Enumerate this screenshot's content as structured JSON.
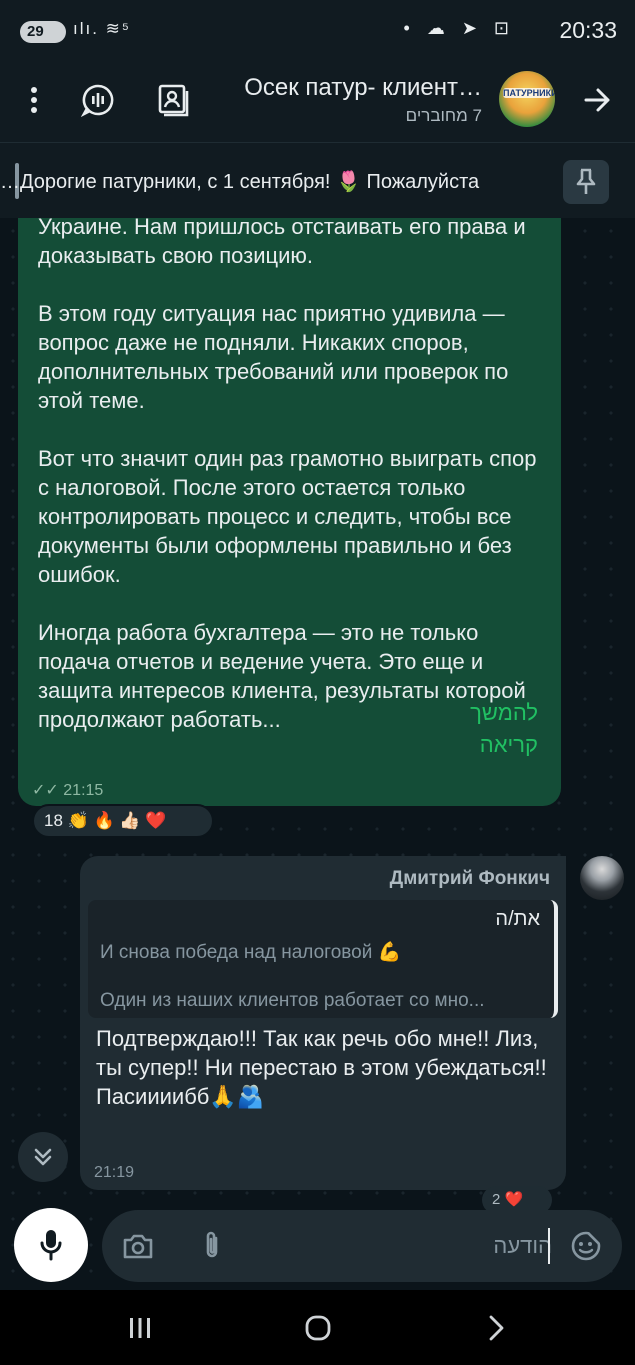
{
  "status_bar": {
    "badge": "29",
    "left_icons": "ılı. ≋⁵",
    "right_icons": "• ☁ ➤ ⊡",
    "time": "20:33"
  },
  "header": {
    "title": "Осек патур- клиент…",
    "subtitle": "7 מחוברים",
    "avatar_text": "ПАТУРНИКИ",
    "icons": [
      "more-vert-icon",
      "voice-chat-icon",
      "contact-card-icon",
      "forward-arrow-icon"
    ]
  },
  "pinned": {
    "text": "…Дорогие патурники, с 1 сентября! 🌷  Пожалуйста"
  },
  "outgoing_message": {
    "paragraphs": [
      "Украине. Нам пришлось отстаивать его права и доказывать свою позицию.",
      "В этом году ситуация нас приятно удивила — вопрос даже не подняли. Никаких споров, дополнительных требований или проверок по этой теме.",
      "Вот что значит один раз грамотно выиграть спор с налоговой. После этого остается только контролировать процесс и следить, чтобы все документы были оформлены правильно и без ошибок."
    ],
    "last_paragraph": "Иногда работа бухгалтера — это не только подача отчетов и ведение учета. Это еще и защита интересов клиента, результаты которой продолжают работать...",
    "read_more": "להמשך קריאה",
    "time": "21:15",
    "ticks": "✓✓"
  },
  "reactions": {
    "count": "18",
    "emojis": "👏 🔥 👍🏻 ❤️"
  },
  "incoming_message": {
    "sender": "Дмитрий Фонкич",
    "quote": {
      "author": "את/ה",
      "line1": "И снова победа над налоговой 💪",
      "line2": "Один из наших клиентов работает со мно..."
    },
    "text": "Подтверждаю!!! Так как речь обо мне!! Лиз, ты супер!! Ни перестаю в этом убеждаться!! Пасиииибб🙏🫂",
    "time": "21:19"
  },
  "peek_reaction": "2 ❤️",
  "composer": {
    "placeholder": "הודעה",
    "icons": [
      "mic-icon",
      "camera-icon",
      "attach-icon",
      "sticker-icon"
    ]
  },
  "nav": {
    "icons": [
      "recents-icon",
      "home-icon",
      "back-icon"
    ]
  }
}
